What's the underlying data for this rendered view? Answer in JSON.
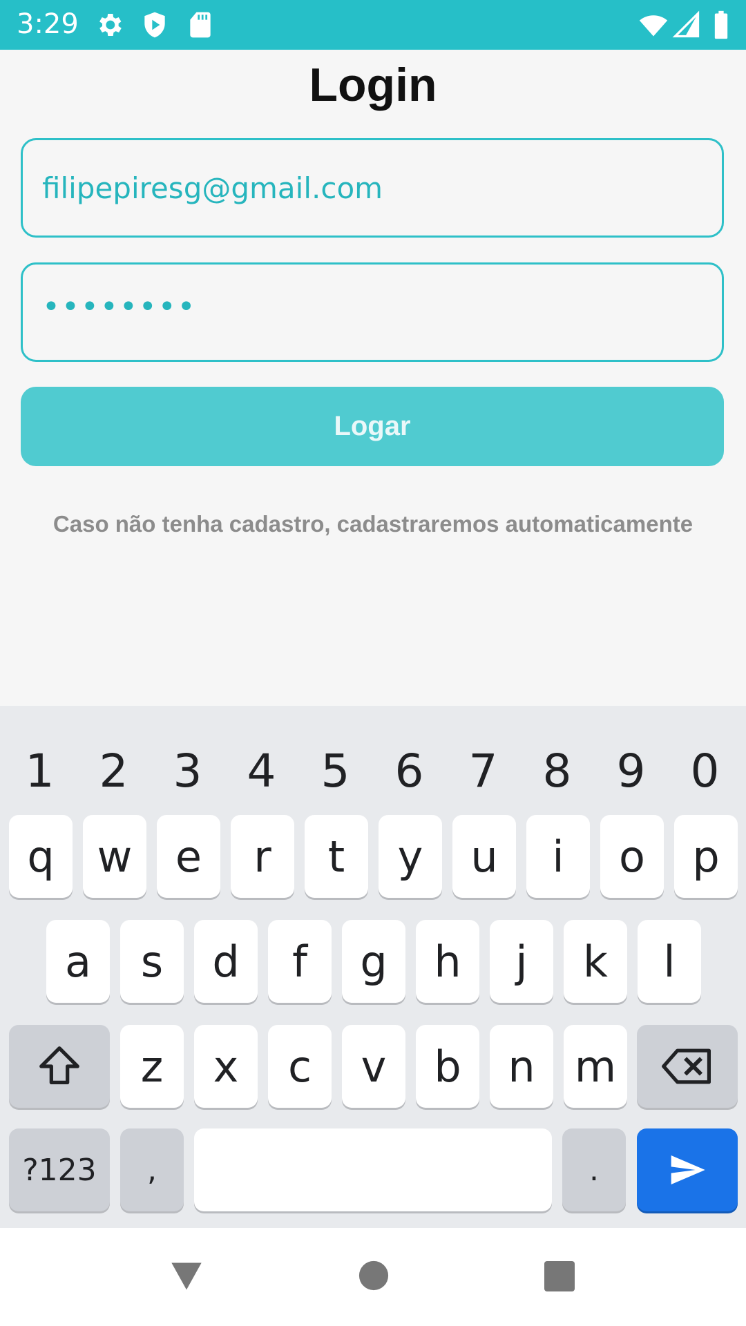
{
  "status_bar": {
    "time": "3:29",
    "left_icons": [
      "gear-icon",
      "shield-play-icon",
      "sd-card-icon"
    ],
    "right_icons": [
      "wifi-icon",
      "signal-icon",
      "battery-icon"
    ],
    "color": "#26bfc8"
  },
  "page": {
    "title": "Login",
    "email_value": "filipepiresg@gmail.com",
    "password_value": "••••••••",
    "login_button": "Logar",
    "hint": "Caso não tenha cadastro, cadastraremos automaticamente"
  },
  "keyboard": {
    "numbers": [
      "1",
      "2",
      "3",
      "4",
      "5",
      "6",
      "7",
      "8",
      "9",
      "0"
    ],
    "row1": [
      "q",
      "w",
      "e",
      "r",
      "t",
      "y",
      "u",
      "i",
      "o",
      "p"
    ],
    "row2": [
      "a",
      "s",
      "d",
      "f",
      "g",
      "h",
      "j",
      "k",
      "l"
    ],
    "row3": [
      "z",
      "x",
      "c",
      "v",
      "b",
      "n",
      "m"
    ],
    "symbols_key": "?123",
    "comma_key": ",",
    "period_key": ".",
    "accent_color": "#1a73e8"
  },
  "nav_bar": {
    "icons": [
      "back-triangle-icon",
      "home-circle-icon",
      "recents-square-icon"
    ]
  }
}
